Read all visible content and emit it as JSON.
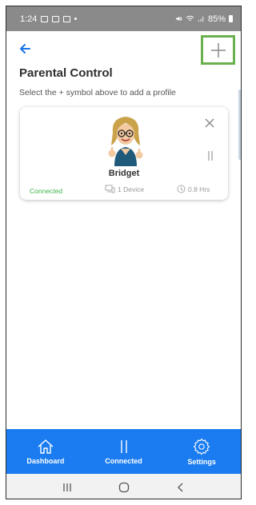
{
  "status_bar": {
    "time": "1:24",
    "battery": "85%"
  },
  "header": {
    "title": "Parental Control",
    "subtitle": "Select the + symbol above to add a profile",
    "back_icon": "back-arrow-icon",
    "add_icon": "plus-icon"
  },
  "profile": {
    "name": "Bridget",
    "status": "Connected",
    "devices": "1 Device",
    "time": "0.8 Hrs"
  },
  "bottom_nav": {
    "items": [
      {
        "label": "Dashboard",
        "icon": "home-icon"
      },
      {
        "label": "Connected",
        "icon": "pause-bars-icon"
      },
      {
        "label": "Settings",
        "icon": "gear-icon"
      }
    ]
  },
  "colors": {
    "accent": "#1a7cf0",
    "connected": "#3fb54a",
    "highlight": "#6ab04c",
    "status_bar": "#8a8a8a"
  }
}
